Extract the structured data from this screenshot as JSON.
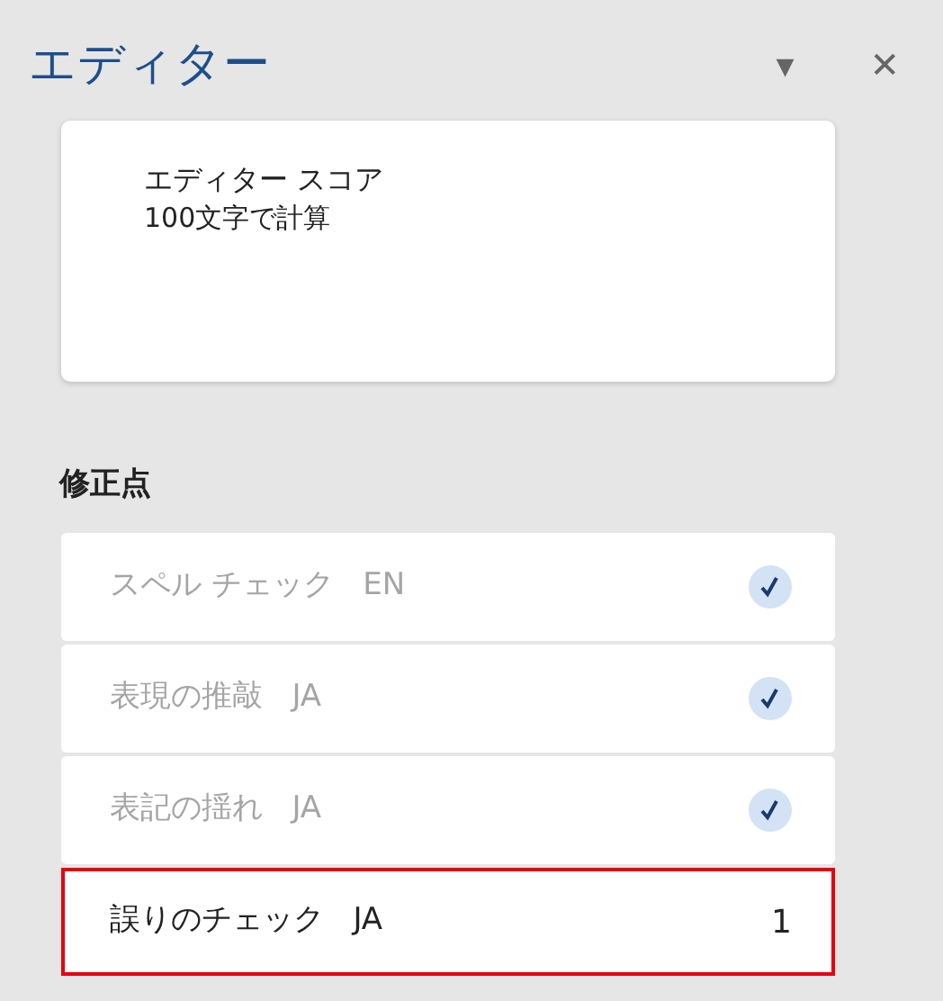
{
  "pane": {
    "title": "エディター",
    "menu_glyph": "▾",
    "close_glyph": "✕"
  },
  "score_card": {
    "title": "エディター スコア",
    "subtitle": "100文字で計算"
  },
  "corrections": {
    "heading": "修正点",
    "items": [
      {
        "label": "スペル チェック",
        "lang": "EN",
        "done": true,
        "highlighted": false
      },
      {
        "label": "表現の推敲",
        "lang": "JA",
        "done": true,
        "highlighted": false
      },
      {
        "label": "表記の揺れ",
        "lang": "JA",
        "done": true,
        "highlighted": false
      },
      {
        "label": "誤りのチェック",
        "lang": "JA",
        "done": false,
        "count": "1",
        "highlighted": true
      }
    ]
  }
}
